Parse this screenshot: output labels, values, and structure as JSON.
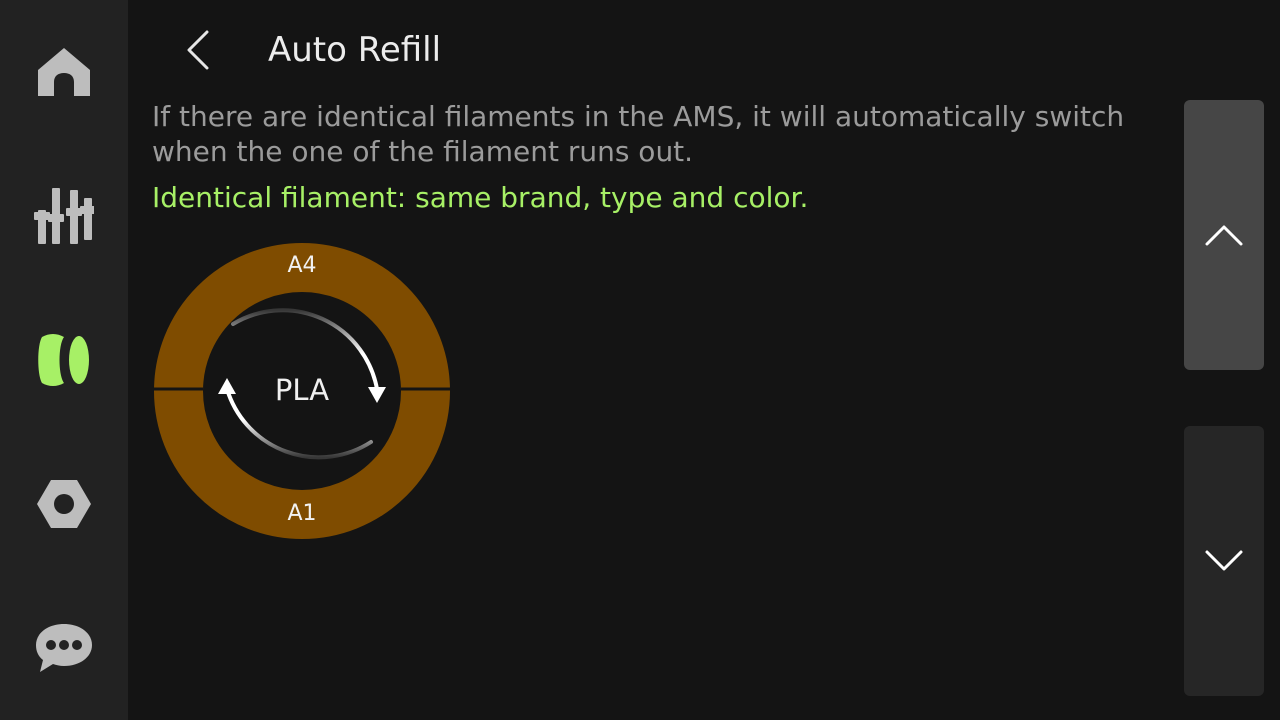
{
  "header": {
    "title": "Auto Refill"
  },
  "content": {
    "description": "If there are identical filaments in the AMS, it will automatically switch when the one of the filament runs out.",
    "note": "Identical filament: same brand, type and color."
  },
  "filament_ring": {
    "top_slot": "A4",
    "bottom_slot": "A1",
    "filament_type": "PLA",
    "filament_color": "#7f4c00"
  },
  "sidebar": {
    "items": [
      {
        "icon": "home-icon",
        "active": false
      },
      {
        "icon": "controls-icon",
        "active": false
      },
      {
        "icon": "filament-icon",
        "active": true
      },
      {
        "icon": "settings-icon",
        "active": false
      },
      {
        "icon": "message-icon",
        "active": false
      }
    ]
  },
  "colors": {
    "accent": "#a7f066",
    "icon_inactive": "#bdbdbd",
    "background": "#141414",
    "sidebar": "#222222"
  }
}
